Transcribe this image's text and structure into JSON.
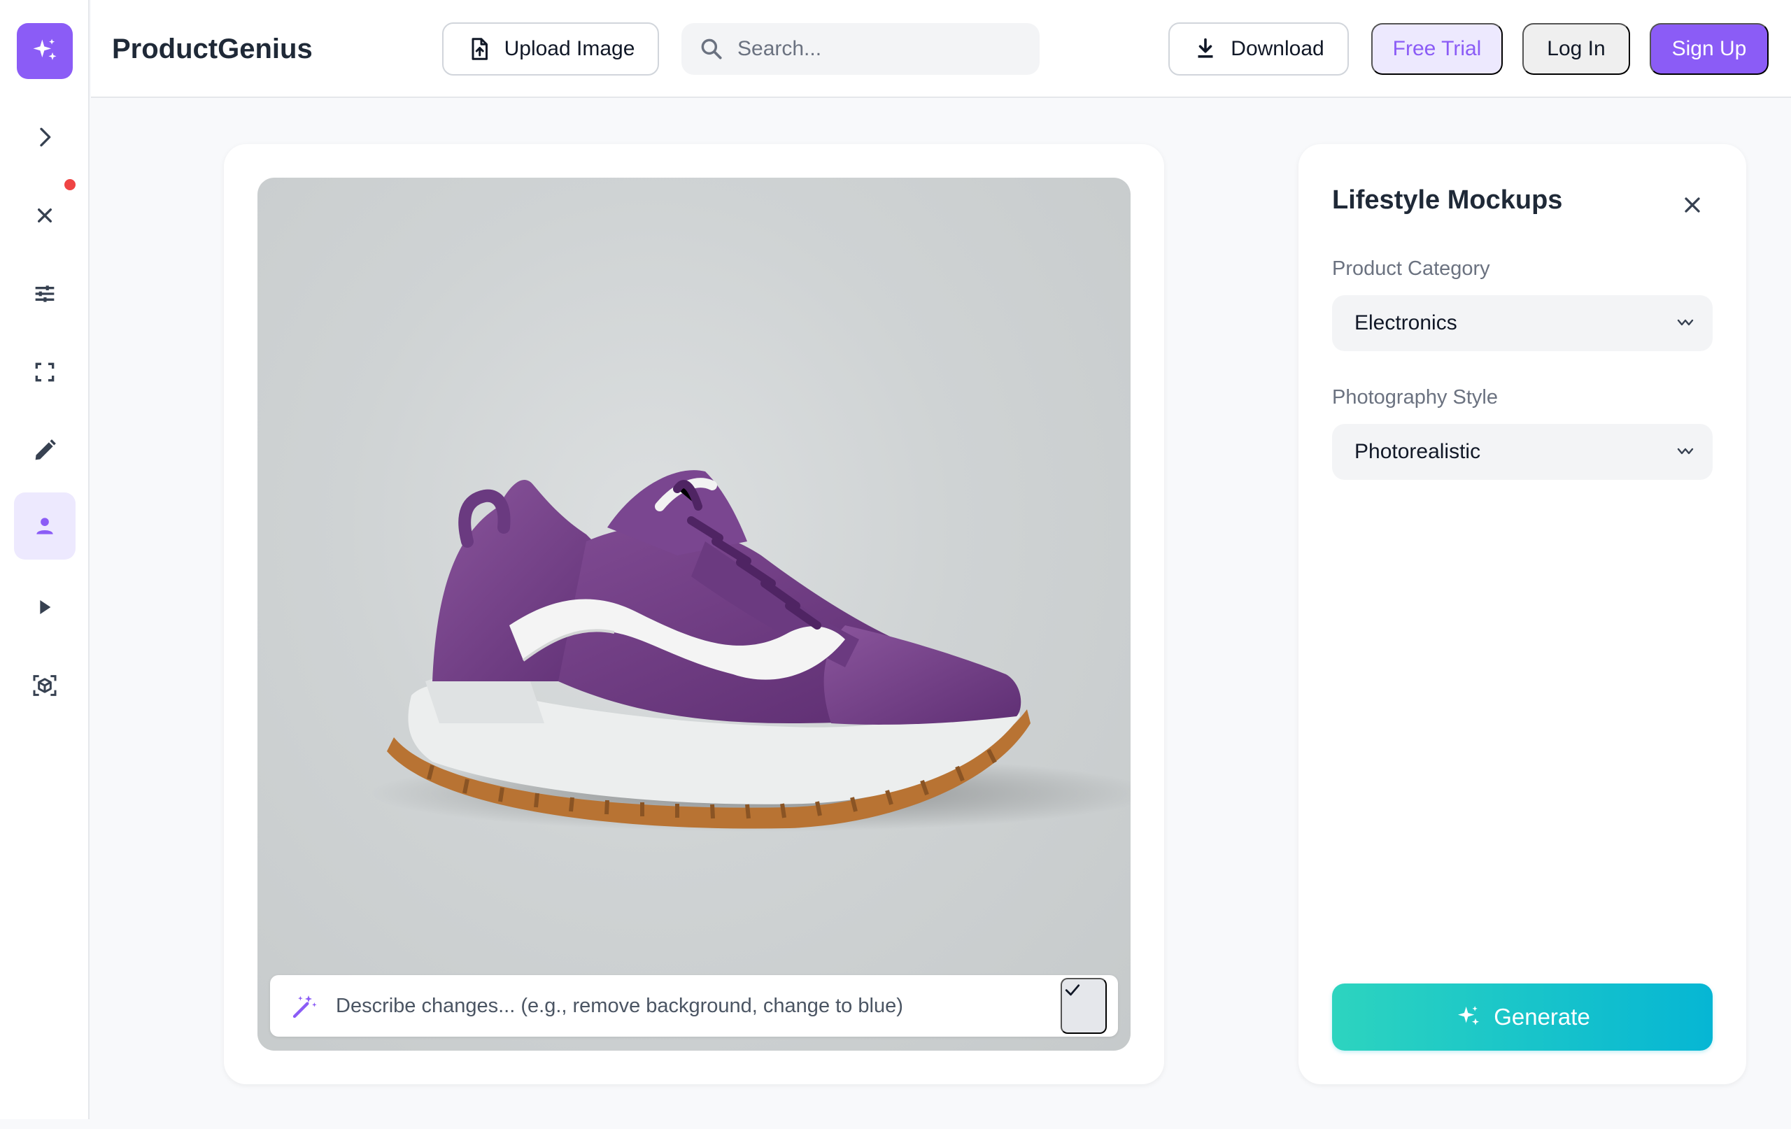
{
  "app": {
    "brand_name": "ProductGenius"
  },
  "header": {
    "upload_label": "Upload Image",
    "upload_icon": "upload-file-icon",
    "search_placeholder": "Search...",
    "search_value": "",
    "download_label": "Download",
    "download_icon": "download-icon",
    "free_trial_label": "Free Trial",
    "login_label": "Log In",
    "signup_label": "Sign Up"
  },
  "sidebar": {
    "logo_icon": "sparkles-icon",
    "items": [
      {
        "icon": "chevron-right-icon",
        "active": false
      },
      {
        "icon": "close-icon",
        "active": false,
        "has_notification": true
      },
      {
        "icon": "sliders-icon",
        "active": false
      },
      {
        "icon": "fullscreen-icon",
        "active": false
      },
      {
        "icon": "pencil-icon",
        "active": false
      },
      {
        "icon": "person-icon",
        "active": true
      },
      {
        "icon": "play-icon",
        "active": false
      },
      {
        "icon": "3d-box-icon",
        "active": false
      }
    ]
  },
  "canvas": {
    "image_subject": "purple suede sneaker with white stripe and gum sole",
    "prompt_placeholder": "Describe changes... (e.g., remove background, change to blue)",
    "prompt_value": "",
    "prompt_icon": "magic-wand-icon",
    "apply_icon": "check-icon"
  },
  "panel": {
    "title": "Lifestyle Mockups",
    "close_icon": "close-icon",
    "fields": [
      {
        "label": "Product Category",
        "value": "Electronics"
      },
      {
        "label": "Photography Style",
        "value": "Photorealistic"
      }
    ],
    "generate_label": "Generate",
    "generate_icon": "sparkles-icon"
  },
  "colors": {
    "accent": "#8b5cf6",
    "accent_soft": "#ede9fe",
    "generate_gradient_start": "#2dd4bf",
    "generate_gradient_end": "#06b6d4",
    "notification": "#ef4444"
  }
}
